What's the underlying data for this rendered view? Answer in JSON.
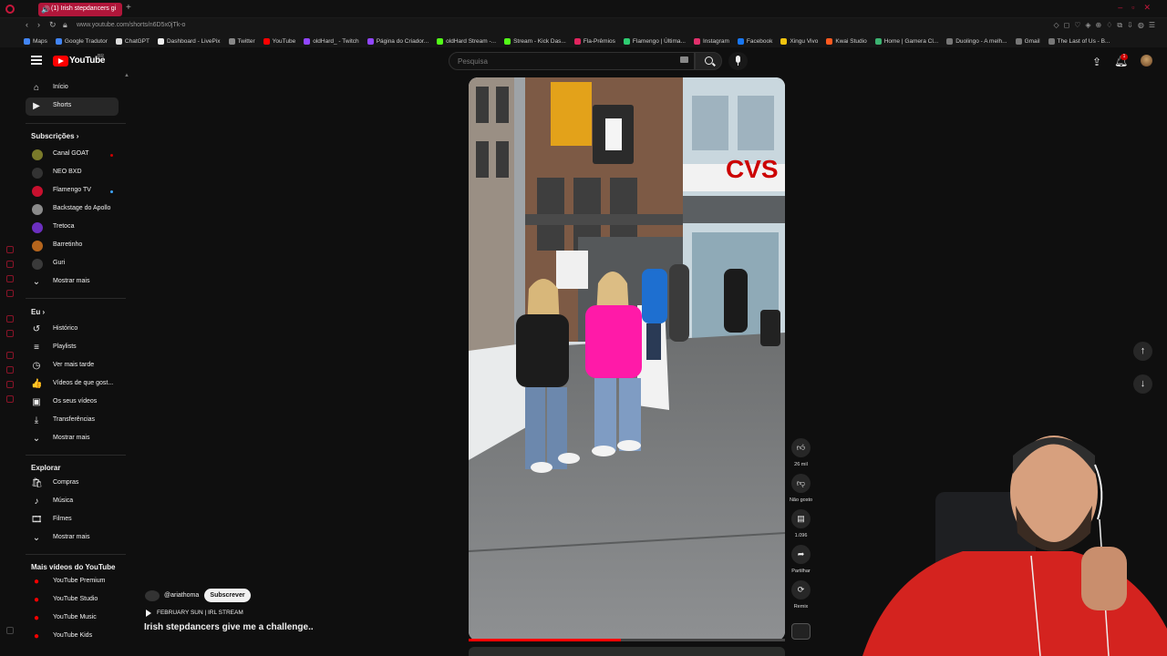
{
  "browser": {
    "tab_title": "(1) Irish stepdancers gi",
    "url": "www.youtube.com/shorts/n6D5x0jTk-o",
    "bookmarks": [
      {
        "label": "Maps",
        "color": "#4285f4"
      },
      {
        "label": "Google Tradutor",
        "color": "#4285f4"
      },
      {
        "label": "ChatGPT",
        "color": "#dddddd"
      },
      {
        "label": "Dashboard - LivePix",
        "color": "#eeeeee"
      },
      {
        "label": "Twitter",
        "color": "#888888"
      },
      {
        "label": "YouTube",
        "color": "#ff0000"
      },
      {
        "label": "oldHard_ - Twitch",
        "color": "#9146ff"
      },
      {
        "label": "Página do Criador...",
        "color": "#9146ff"
      },
      {
        "label": "oldHard Stream -...",
        "color": "#53fc18"
      },
      {
        "label": "Stream - Kick Das...",
        "color": "#53fc18"
      },
      {
        "label": "Fla-Prêmios",
        "color": "#e0245e"
      },
      {
        "label": "Flamengo | Última...",
        "color": "#2ecc71"
      },
      {
        "label": "Instagram",
        "color": "#e1306c"
      },
      {
        "label": "Facebook",
        "color": "#1877f2"
      },
      {
        "label": "Xingu Vivo",
        "color": "#f1c40f"
      },
      {
        "label": "Kwai Studio",
        "color": "#ff5a1f"
      },
      {
        "label": "Home | Gamera Cl...",
        "color": "#3cb371"
      },
      {
        "label": "Duolingo - A melh...",
        "color": "#777777"
      },
      {
        "label": "Gmail",
        "color": "#777777"
      },
      {
        "label": "The Last of Us - B...",
        "color": "#777777"
      }
    ]
  },
  "masthead": {
    "logo_text": "YouTube",
    "country": "BR",
    "search_placeholder": "Pesquisa",
    "notification_count": "1"
  },
  "sidebar": {
    "main": [
      {
        "label": "Início",
        "icon": "home-icon",
        "glyph": "⌂"
      },
      {
        "label": "Shorts",
        "icon": "shorts-icon",
        "glyph": "▶"
      }
    ],
    "subscriptions_header": "Subscrições",
    "subscriptions": [
      {
        "label": "Canal GOAT",
        "color": "#7a7a2a",
        "live": "#cc0000"
      },
      {
        "label": "NEO BXD",
        "color": "#333333",
        "live": ""
      },
      {
        "label": "Flamengo TV",
        "color": "#c8102e",
        "live": "#3ea6ff"
      },
      {
        "label": "Backstage do Apollo",
        "color": "#8a8a8a",
        "live": ""
      },
      {
        "label": "Tretoca",
        "color": "#6b2fbf",
        "live": ""
      },
      {
        "label": "Barretinho",
        "color": "#b5651d",
        "live": ""
      },
      {
        "label": "Guri",
        "color": "#3a3a3a",
        "live": ""
      }
    ],
    "show_more_1": "Mostrar mais",
    "you_header": "Eu",
    "you_items": [
      {
        "label": "Histórico",
        "icon": "history-icon",
        "glyph": "↺"
      },
      {
        "label": "Playlists",
        "icon": "playlists-icon",
        "glyph": "≡"
      },
      {
        "label": "Ver mais tarde",
        "icon": "watch-later-icon",
        "glyph": "◷"
      },
      {
        "label": "Vídeos de que gost...",
        "icon": "like-icon",
        "glyph": "👍"
      },
      {
        "label": "Os seus vídeos",
        "icon": "your-videos-icon",
        "glyph": "▣"
      },
      {
        "label": "Transferências",
        "icon": "download-icon",
        "glyph": "⤓"
      }
    ],
    "show_more_2": "Mostrar mais",
    "explore_header": "Explorar",
    "explore_items": [
      {
        "label": "Compras",
        "icon": "shopping-icon",
        "glyph": "🛍"
      },
      {
        "label": "Música",
        "icon": "music-icon",
        "glyph": "♪"
      },
      {
        "label": "Filmes",
        "icon": "movies-icon",
        "glyph": "🎞"
      }
    ],
    "show_more_3": "Mostrar mais",
    "more_header": "Mais vídeos do YouTube",
    "more_items": [
      {
        "label": "YouTube Premium"
      },
      {
        "label": "YouTube Studio"
      },
      {
        "label": "YouTube Music"
      },
      {
        "label": "YouTube Kids"
      }
    ]
  },
  "short": {
    "channel": "@ariathoma",
    "subscribe_label": "Subscrever",
    "sound": "FEBRUARY SUN | IRL STREAM",
    "title": "Irish stepdancers give me a challenge..",
    "progress": 0.48,
    "store_sign": "CVS"
  },
  "actions": {
    "like_count": "26 mil",
    "dislike_label": "Não gosto",
    "comment_count": "1.096",
    "share_label": "Partilhar",
    "remix_label": "Remix"
  },
  "accent_color": "#ff0000"
}
